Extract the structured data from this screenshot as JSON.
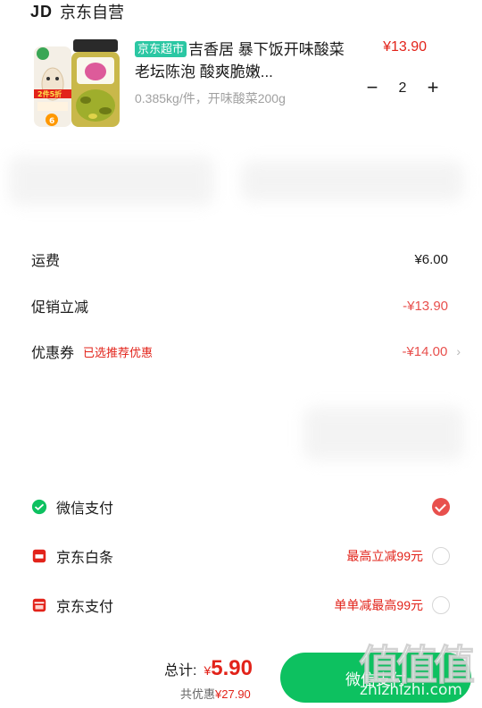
{
  "shop": {
    "logo": "JD",
    "name": "京东自营"
  },
  "product": {
    "badge": "京东超市",
    "title": "吉香居 暴下饭开味酸菜 老坛陈泡 酸爽脆嫩...",
    "spec": "0.385kg/件，开味酸菜200g",
    "price": "¥13.90",
    "quantity": "2",
    "image_promo": "2件5折",
    "image_count": "6"
  },
  "fees": {
    "shipping_label": "运费",
    "shipping_value": "¥6.00",
    "promo_label": "促销立减",
    "promo_value": "-¥13.90",
    "coupon_label": "优惠券",
    "coupon_tip": "已选推荐优惠",
    "coupon_value": "-¥14.00"
  },
  "payment_methods": [
    {
      "label": "微信支付",
      "promo": "",
      "selected": true,
      "icon": "wechat-pay-icon"
    },
    {
      "label": "京东白条",
      "promo": "最高立减99元",
      "selected": false,
      "icon": "jd-baitiao-icon"
    },
    {
      "label": "京东支付",
      "promo": "单单减最高99元",
      "selected": false,
      "icon": "jd-pay-icon"
    }
  ],
  "footer": {
    "total_label": "总计:",
    "currency": "¥",
    "total_amount": "5.90",
    "savings_label": "共优惠",
    "savings_amount": "¥27.90",
    "pay_button": "微信支付"
  },
  "watermark": {
    "glyphs": "值值值",
    "url": "zhizhizhi.com"
  },
  "colors": {
    "price_red": "#e2231a",
    "wechat_green": "#0dc160",
    "badge_teal": "#2bc7a3",
    "radio_red": "#e8504d"
  }
}
